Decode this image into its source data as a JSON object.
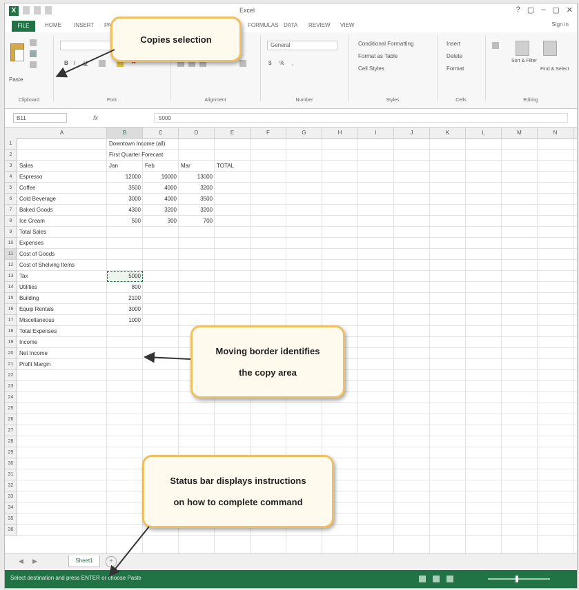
{
  "window": {
    "title": "Excel",
    "app_icon": "X",
    "controls": [
      "?",
      "▢",
      "–",
      "▢",
      "✕"
    ]
  },
  "tabs": {
    "file": "FILE",
    "items": [
      "HOME",
      "INSERT",
      "PAGE LAYOUT",
      "FORMULAS",
      "DATA",
      "REVIEW",
      "VIEW"
    ],
    "signin": "Sign in"
  },
  "ribbon": {
    "groups": [
      "Clipboard",
      "Font",
      "Alignment",
      "Number",
      "Styles",
      "Cells",
      "Editing"
    ],
    "paste_label": "Paste",
    "number_format": "General",
    "styles": [
      "Conditional Formatting",
      "Format as Table",
      "Cell Styles"
    ],
    "cells": [
      "Insert",
      "Delete",
      "Format"
    ],
    "editing": [
      "Sort & Filter",
      "Find & Select"
    ]
  },
  "formula_bar": {
    "name_box": "B11",
    "fx": "fx",
    "content": "5000"
  },
  "columns": [
    "A",
    "B",
    "C",
    "D",
    "E",
    "F",
    "G",
    "H",
    "I",
    "J",
    "K",
    "L",
    "M",
    "N",
    "O"
  ],
  "rows": [
    "1",
    "2",
    "3",
    "4",
    "5",
    "6",
    "7",
    "8",
    "9",
    "10",
    "11",
    "12",
    "13",
    "14",
    "15",
    "16",
    "17",
    "18",
    "19",
    "20",
    "21",
    "22",
    "23",
    "24",
    "25",
    "26",
    "27",
    "28",
    "29",
    "30",
    "31",
    "32",
    "33",
    "34",
    "35",
    "36"
  ],
  "sheet": {
    "b1": "Downtown Income (all)",
    "b2": "First Quarter Forecast",
    "a3": "Sales",
    "b3": "Jan",
    "c3": "Feb",
    "d3": "Mar",
    "e3": "TOTAL",
    "labels_a": [
      "Espresso",
      "Coffee",
      "Cold Beverage",
      "Baked Goods",
      "Ice Cream",
      "Total Sales",
      "Expenses",
      "Cost of Goods",
      "Cost of Shelving Items",
      "Tax",
      "Utilities",
      "Building",
      "Equip Rentals",
      "Miscellaneous",
      "Total Expenses",
      "Income",
      "Net Income",
      "Profit Margin"
    ],
    "data_rows": [
      [
        "12000",
        "10000",
        "13000"
      ],
      [
        "3500",
        "4000",
        "3200"
      ],
      [
        "3000",
        "4000",
        "3500"
      ],
      [
        "4300",
        "3200",
        "3200"
      ],
      [
        "500",
        "300",
        "700"
      ]
    ],
    "col_b_extra": [
      "5000",
      "800",
      "2100",
      "3000",
      "1000"
    ]
  },
  "sheet_tabs": {
    "active": "Sheet1",
    "add": "+"
  },
  "status_bar": {
    "message": "Select destination and press ENTER or choose Paste"
  },
  "callouts": {
    "copies": "Copies selection",
    "moving_line1": "Moving border identifies",
    "moving_line2": "the copy area",
    "status_line1": "Status bar displays instructions",
    "status_line2": "on how to complete command"
  },
  "colors": {
    "excel_green": "#217346",
    "callout_border": "#f0c060",
    "callout_fill": "#fff9ee"
  }
}
